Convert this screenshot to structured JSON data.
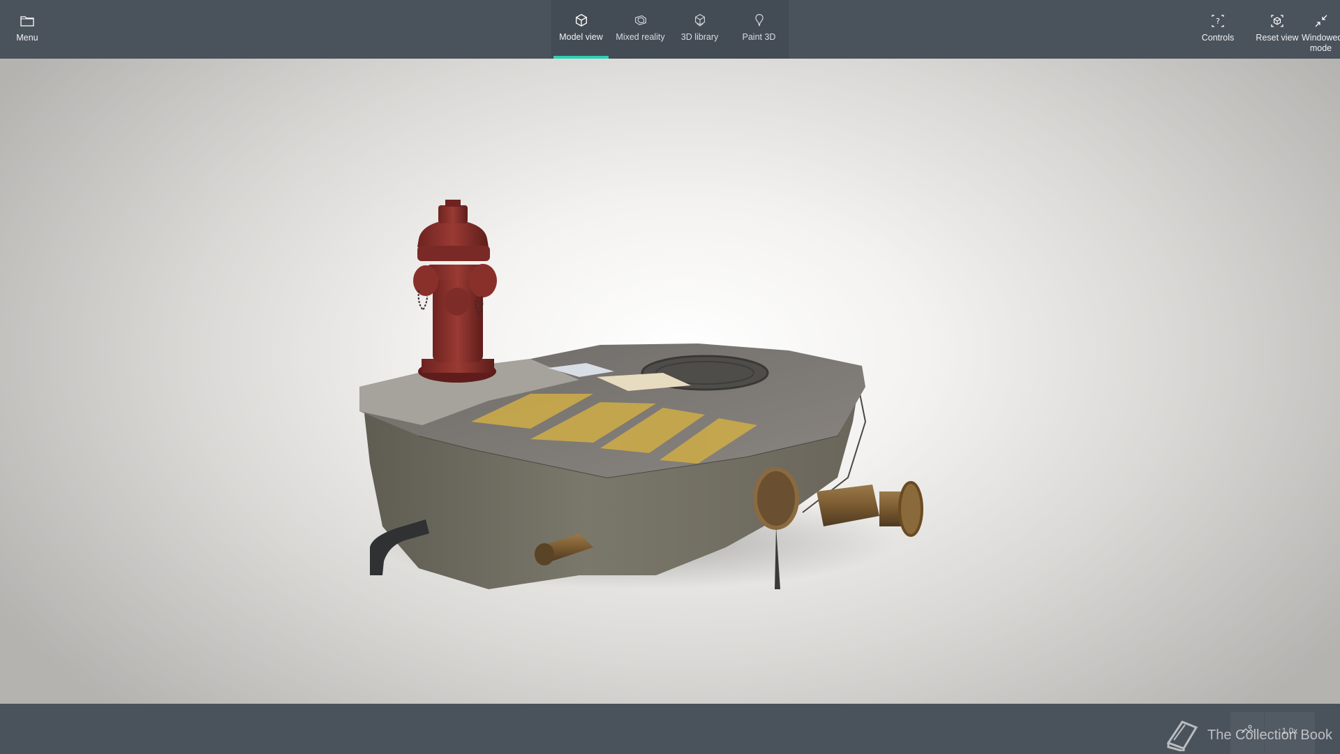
{
  "topbar": {
    "menu_label": "Menu",
    "tabs": [
      {
        "label": "Model view",
        "icon": "cube-icon",
        "active": true
      },
      {
        "label": "Mixed reality",
        "icon": "mixed-reality-icon",
        "active": false
      },
      {
        "label": "3D library",
        "icon": "3d-library-icon",
        "active": false
      },
      {
        "label": "Paint 3D",
        "icon": "paint-3d-icon",
        "active": false
      }
    ],
    "controls_label": "Controls",
    "reset_view_label": "Reset view",
    "windowed_mode_label": "Windowed mode"
  },
  "bottombar": {
    "zoom_label": "1.0x",
    "environment_icon": "environment-icon"
  },
  "watermark": {
    "text": "The Collection Book",
    "icon": "book-icon"
  },
  "colors": {
    "toolbar_bg": "#4a525c",
    "tabs_bg": "#434b54",
    "accent": "#2ed0b2",
    "text": "#ffffff"
  },
  "model": {
    "subject": "fire hydrant on concrete block"
  }
}
